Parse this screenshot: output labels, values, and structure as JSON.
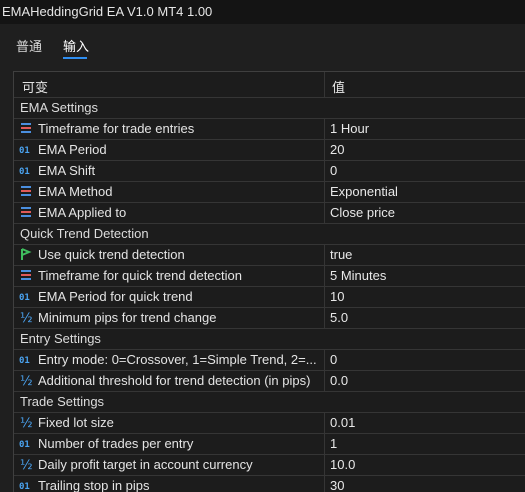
{
  "window": {
    "title": "EMAHeddingGrid EA V1.0 MT4 1.00"
  },
  "tabs": [
    {
      "label": "普通"
    },
    {
      "label": "输入"
    }
  ],
  "table": {
    "header": {
      "name": "可变",
      "value": "值"
    },
    "rows": [
      {
        "section": "EMA Settings"
      },
      {
        "icon": "list-icon",
        "name": "Timeframe for trade entries",
        "value": "1 Hour"
      },
      {
        "icon": "integer-icon",
        "name": "EMA Period",
        "value": "20"
      },
      {
        "icon": "integer-icon",
        "name": "EMA Shift",
        "value": "0"
      },
      {
        "icon": "list-icon",
        "name": "EMA Method",
        "value": "Exponential"
      },
      {
        "icon": "list-icon",
        "name": "EMA Applied to",
        "value": "Close price"
      },
      {
        "section": "Quick Trend Detection"
      },
      {
        "icon": "boolean-icon",
        "name": "Use quick trend detection",
        "value": "true"
      },
      {
        "icon": "list-icon",
        "name": "Timeframe for quick trend detection",
        "value": "5 Minutes"
      },
      {
        "icon": "integer-icon",
        "name": "EMA Period for quick trend",
        "value": "10"
      },
      {
        "icon": "double-icon",
        "name": "Minimum pips for trend change",
        "value": "5.0"
      },
      {
        "section": "Entry Settings"
      },
      {
        "icon": "integer-icon",
        "name": "Entry mode: 0=Crossover, 1=Simple Trend, 2=...",
        "value": "0"
      },
      {
        "icon": "double-icon",
        "name": "Additional threshold for trend detection (in pips)",
        "value": "0.0"
      },
      {
        "section": "Trade Settings"
      },
      {
        "icon": "double-icon",
        "name": "Fixed lot size",
        "value": "0.01"
      },
      {
        "icon": "integer-icon",
        "name": "Number of trades per entry",
        "value": "1"
      },
      {
        "icon": "double-icon",
        "name": "Daily profit target in account currency",
        "value": "10.0"
      },
      {
        "icon": "integer-icon",
        "name": "Trailing stop in pips",
        "value": "30"
      }
    ]
  },
  "colors": {
    "list_icon_bars": [
      "#4a8fe0",
      "#e05a5a",
      "#4a8fe0"
    ],
    "integer_icon": "#4aa3f0",
    "double_icon": "#4aa3f0",
    "boolean_icon": "#3fbf5f",
    "tab_underline": "#2f8ef0"
  }
}
